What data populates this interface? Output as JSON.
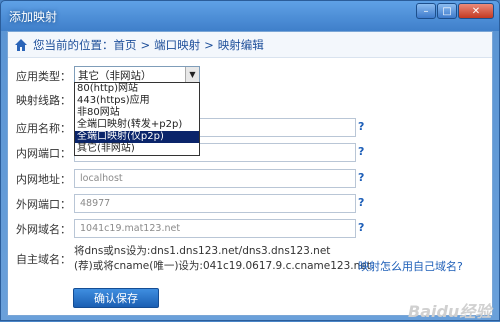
{
  "window": {
    "title": "添加映射",
    "min": "–",
    "max": "□",
    "close": "✕"
  },
  "breadcrumb": {
    "prefix": "您当前的位置：首页",
    "sep1": ">",
    "item1": "端口映射",
    "sep2": ">",
    "item2": "映射编辑"
  },
  "form": {
    "app_type_label": "应用类型：",
    "app_type_value": "其它（非网站）",
    "mapping_path_label": "映射线路：",
    "app_name_label": "应用名称：",
    "inner_port_label": "内网端口：",
    "inner_addr_label": "内网地址：",
    "inner_addr_value": "localhost",
    "outer_port_label": "外网端口：",
    "outer_port_value": "48977",
    "outer_domain_label": "外网域名：",
    "outer_domain_value": "1041c19.mat123.net",
    "custom_domain_label": "自主域名：",
    "custom_line1": "将dns或ns设为:dns1.dns123.net/dns3.dns123.net",
    "custom_line2": "(荐)或将cname(唯一)设为:041c19.0617.9.c.cname123.net",
    "custom_link": "映射怎么用自己域名?",
    "help": "?",
    "save_label": "确认保存"
  },
  "dropdown": [
    "80(http)网站",
    "443(https)应用",
    "非80网站",
    "全端口映射(转发+p2p)",
    "全端口映射(仅p2p)",
    "其它(非网站)"
  ],
  "dropdown_selected_index": 4,
  "watermark": "Baidu经验"
}
